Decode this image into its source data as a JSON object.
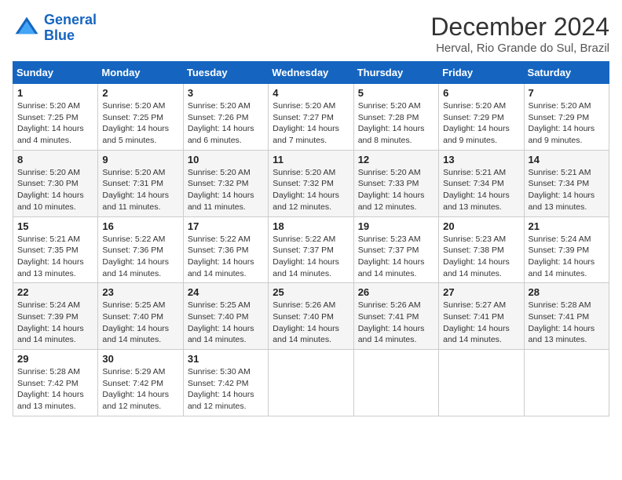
{
  "header": {
    "logo_line1": "General",
    "logo_line2": "Blue",
    "main_title": "December 2024",
    "subtitle": "Herval, Rio Grande do Sul, Brazil"
  },
  "calendar": {
    "weekdays": [
      "Sunday",
      "Monday",
      "Tuesday",
      "Wednesday",
      "Thursday",
      "Friday",
      "Saturday"
    ],
    "weeks": [
      [
        {
          "day": "1",
          "sunrise": "5:20 AM",
          "sunset": "7:25 PM",
          "daylight": "14 hours and 4 minutes."
        },
        {
          "day": "2",
          "sunrise": "5:20 AM",
          "sunset": "7:25 PM",
          "daylight": "14 hours and 5 minutes."
        },
        {
          "day": "3",
          "sunrise": "5:20 AM",
          "sunset": "7:26 PM",
          "daylight": "14 hours and 6 minutes."
        },
        {
          "day": "4",
          "sunrise": "5:20 AM",
          "sunset": "7:27 PM",
          "daylight": "14 hours and 7 minutes."
        },
        {
          "day": "5",
          "sunrise": "5:20 AM",
          "sunset": "7:28 PM",
          "daylight": "14 hours and 8 minutes."
        },
        {
          "day": "6",
          "sunrise": "5:20 AM",
          "sunset": "7:29 PM",
          "daylight": "14 hours and 9 minutes."
        },
        {
          "day": "7",
          "sunrise": "5:20 AM",
          "sunset": "7:29 PM",
          "daylight": "14 hours and 9 minutes."
        }
      ],
      [
        {
          "day": "8",
          "sunrise": "5:20 AM",
          "sunset": "7:30 PM",
          "daylight": "14 hours and 10 minutes."
        },
        {
          "day": "9",
          "sunrise": "5:20 AM",
          "sunset": "7:31 PM",
          "daylight": "14 hours and 11 minutes."
        },
        {
          "day": "10",
          "sunrise": "5:20 AM",
          "sunset": "7:32 PM",
          "daylight": "14 hours and 11 minutes."
        },
        {
          "day": "11",
          "sunrise": "5:20 AM",
          "sunset": "7:32 PM",
          "daylight": "14 hours and 12 minutes."
        },
        {
          "day": "12",
          "sunrise": "5:20 AM",
          "sunset": "7:33 PM",
          "daylight": "14 hours and 12 minutes."
        },
        {
          "day": "13",
          "sunrise": "5:21 AM",
          "sunset": "7:34 PM",
          "daylight": "14 hours and 13 minutes."
        },
        {
          "day": "14",
          "sunrise": "5:21 AM",
          "sunset": "7:34 PM",
          "daylight": "14 hours and 13 minutes."
        }
      ],
      [
        {
          "day": "15",
          "sunrise": "5:21 AM",
          "sunset": "7:35 PM",
          "daylight": "14 hours and 13 minutes."
        },
        {
          "day": "16",
          "sunrise": "5:22 AM",
          "sunset": "7:36 PM",
          "daylight": "14 hours and 14 minutes."
        },
        {
          "day": "17",
          "sunrise": "5:22 AM",
          "sunset": "7:36 PM",
          "daylight": "14 hours and 14 minutes."
        },
        {
          "day": "18",
          "sunrise": "5:22 AM",
          "sunset": "7:37 PM",
          "daylight": "14 hours and 14 minutes."
        },
        {
          "day": "19",
          "sunrise": "5:23 AM",
          "sunset": "7:37 PM",
          "daylight": "14 hours and 14 minutes."
        },
        {
          "day": "20",
          "sunrise": "5:23 AM",
          "sunset": "7:38 PM",
          "daylight": "14 hours and 14 minutes."
        },
        {
          "day": "21",
          "sunrise": "5:24 AM",
          "sunset": "7:39 PM",
          "daylight": "14 hours and 14 minutes."
        }
      ],
      [
        {
          "day": "22",
          "sunrise": "5:24 AM",
          "sunset": "7:39 PM",
          "daylight": "14 hours and 14 minutes."
        },
        {
          "day": "23",
          "sunrise": "5:25 AM",
          "sunset": "7:40 PM",
          "daylight": "14 hours and 14 minutes."
        },
        {
          "day": "24",
          "sunrise": "5:25 AM",
          "sunset": "7:40 PM",
          "daylight": "14 hours and 14 minutes."
        },
        {
          "day": "25",
          "sunrise": "5:26 AM",
          "sunset": "7:40 PM",
          "daylight": "14 hours and 14 minutes."
        },
        {
          "day": "26",
          "sunrise": "5:26 AM",
          "sunset": "7:41 PM",
          "daylight": "14 hours and 14 minutes."
        },
        {
          "day": "27",
          "sunrise": "5:27 AM",
          "sunset": "7:41 PM",
          "daylight": "14 hours and 14 minutes."
        },
        {
          "day": "28",
          "sunrise": "5:28 AM",
          "sunset": "7:41 PM",
          "daylight": "14 hours and 13 minutes."
        }
      ],
      [
        {
          "day": "29",
          "sunrise": "5:28 AM",
          "sunset": "7:42 PM",
          "daylight": "14 hours and 13 minutes."
        },
        {
          "day": "30",
          "sunrise": "5:29 AM",
          "sunset": "7:42 PM",
          "daylight": "14 hours and 12 minutes."
        },
        {
          "day": "31",
          "sunrise": "5:30 AM",
          "sunset": "7:42 PM",
          "daylight": "14 hours and 12 minutes."
        },
        null,
        null,
        null,
        null
      ]
    ]
  }
}
